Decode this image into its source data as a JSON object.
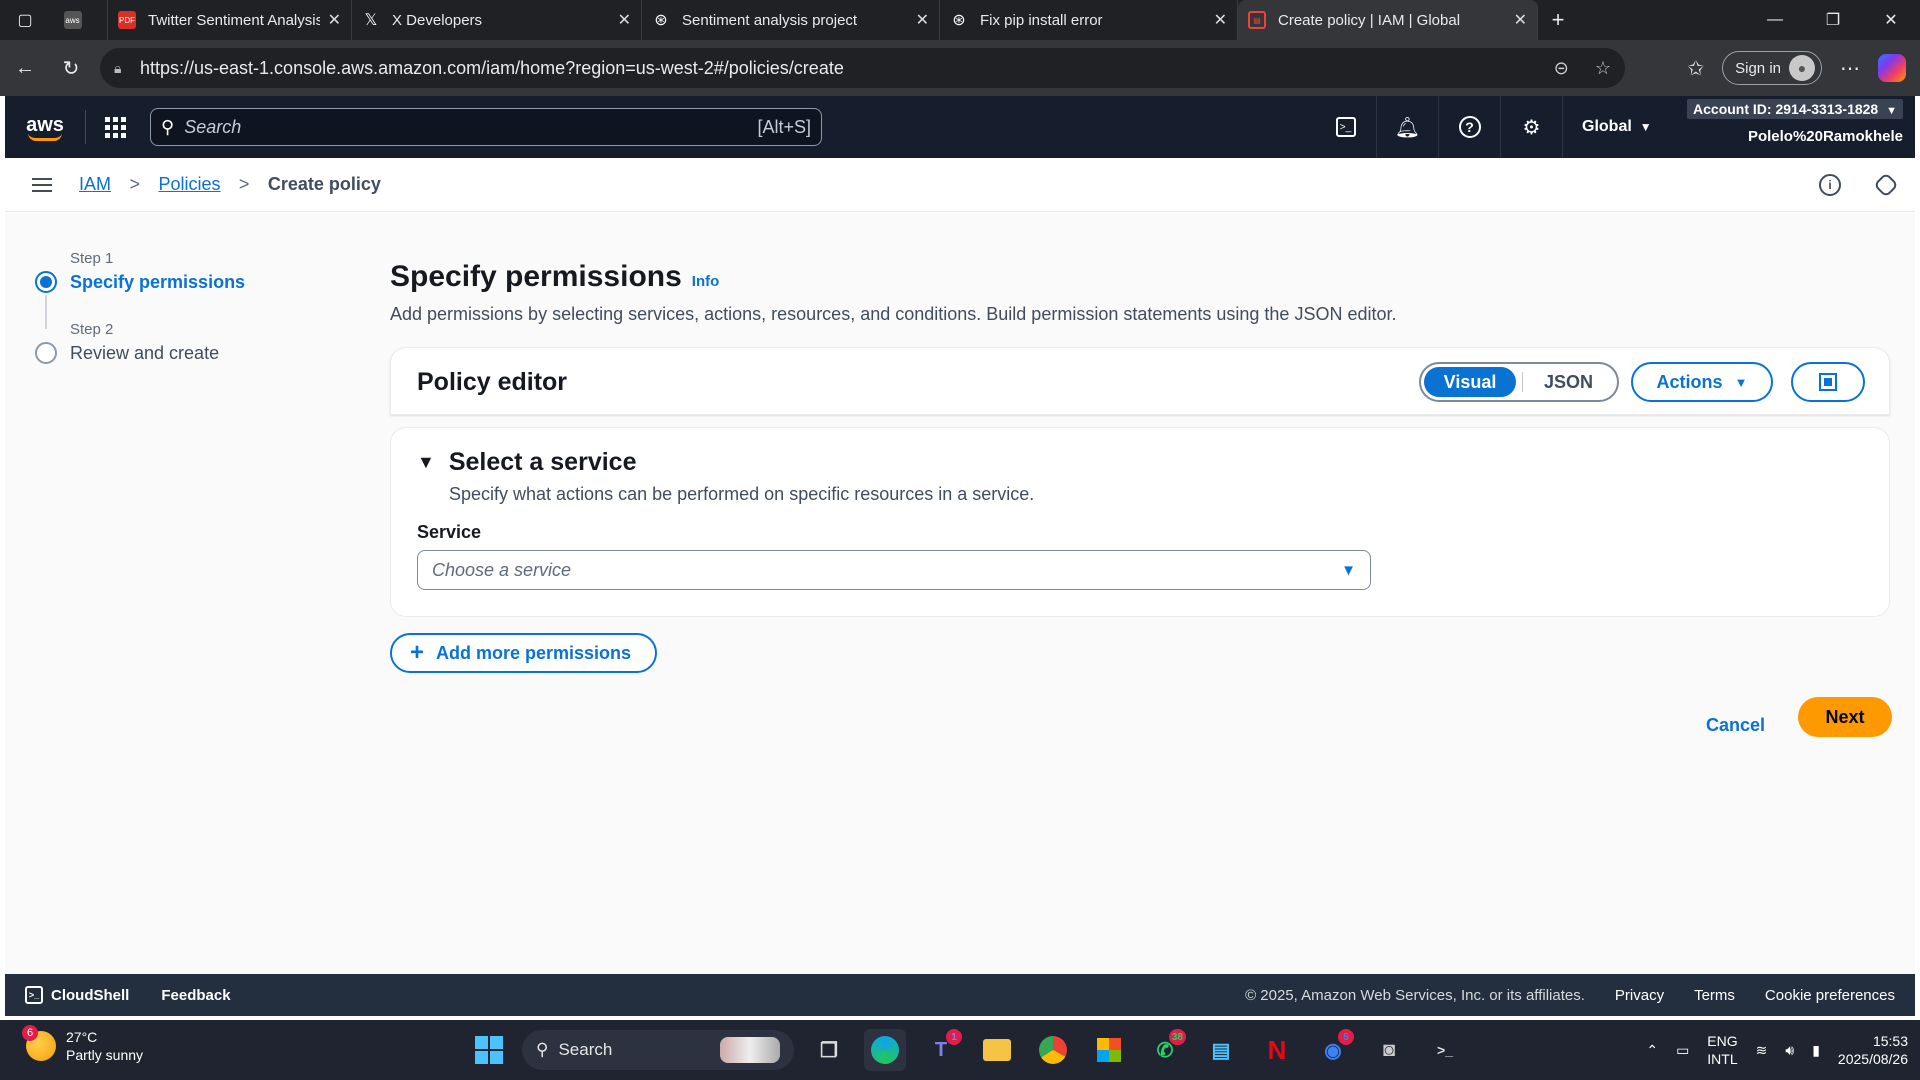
{
  "browser": {
    "tabs": [
      {
        "title": "",
        "icon": "aws-favicon"
      },
      {
        "title": "Twitter Sentiment Analysis Project",
        "icon": "pdf-favicon"
      },
      {
        "title": "X Developers",
        "icon": "x-favicon"
      },
      {
        "title": "Sentiment analysis project",
        "icon": "chatgpt-favicon"
      },
      {
        "title": "Fix pip install error",
        "icon": "chatgpt-favicon"
      },
      {
        "title": "Create policy | IAM | Global",
        "icon": "aws-favicon"
      }
    ],
    "url": "https://us-east-1.console.aws.amazon.com/iam/home?region=us-west-2#/policies/create",
    "sign_in": "Sign in"
  },
  "aws_nav": {
    "logo": "aws",
    "search_placeholder": "Search",
    "search_shortcut": "[Alt+S]",
    "region": "Global",
    "account_id": "Account ID: 2914-3313-1828",
    "user": "Polelo%20Ramokhele"
  },
  "breadcrumb": {
    "items": [
      "IAM",
      "Policies"
    ],
    "current": "Create policy"
  },
  "steps": [
    {
      "label": "Step 1",
      "name": "Specify permissions",
      "active": true
    },
    {
      "label": "Step 2",
      "name": "Review and create",
      "active": false
    }
  ],
  "page": {
    "title": "Specify permissions",
    "info": "Info",
    "description": "Add permissions by selecting services, actions, resources, and conditions. Build permission statements using the JSON editor."
  },
  "policy_editor": {
    "title": "Policy editor",
    "mode_visual": "Visual",
    "mode_json": "JSON",
    "actions": "Actions"
  },
  "service_section": {
    "title": "Select a service",
    "subtitle": "Specify what actions can be performed on specific resources in a service.",
    "label": "Service",
    "placeholder": "Choose a service"
  },
  "buttons": {
    "add_more": "Add more permissions",
    "cancel": "Cancel",
    "next": "Next"
  },
  "aws_footer": {
    "cloudshell": "CloudShell",
    "feedback": "Feedback",
    "copyright": "© 2025, Amazon Web Services, Inc. or its affiliates.",
    "privacy": "Privacy",
    "terms": "Terms",
    "cookies": "Cookie preferences"
  },
  "taskbar": {
    "weather_badge": "6",
    "temperature": "27°C",
    "condition": "Partly sunny",
    "search": "Search",
    "teams_badge": "1",
    "whatsapp_badge": "38",
    "messenger_badge": "5",
    "lang1": "ENG",
    "lang2": "INTL",
    "time": "15:53",
    "date": "2025/08/26"
  },
  "colors": {
    "aws_nav_bg": "#161e2d",
    "link_blue": "#0972d3",
    "next_orange": "#ff9900"
  }
}
